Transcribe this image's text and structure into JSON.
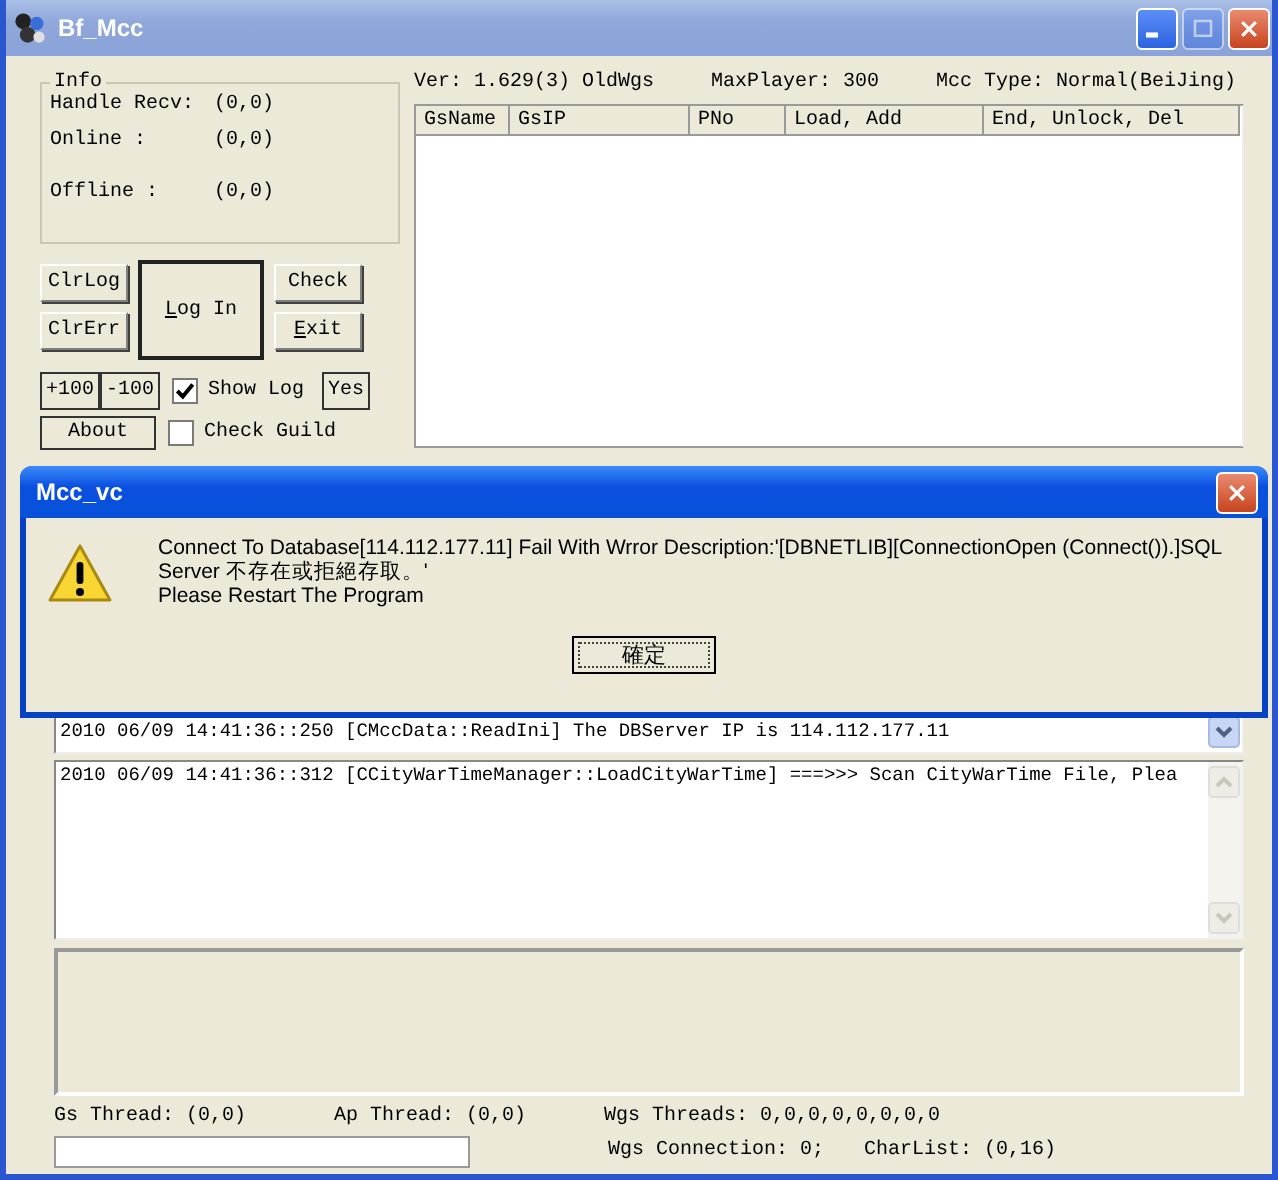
{
  "window": {
    "title": "Bf_Mcc",
    "controls": [
      {
        "kind": "minimize",
        "disabled": false
      },
      {
        "kind": "maximize",
        "disabled": true
      },
      {
        "kind": "close",
        "disabled": false
      }
    ]
  },
  "info": {
    "title": "Info",
    "rows": [
      {
        "label": "Handle Recv:",
        "value": "(0,0)"
      },
      {
        "label": "Online :",
        "value": "(0,0)"
      },
      {
        "label": "Offline :",
        "value": "(0,0)"
      }
    ]
  },
  "buttons": {
    "clr_log": {
      "label": "ClrLog",
      "mnemonic": false
    },
    "clr_err": {
      "label": "ClrErr",
      "mnemonic": false
    },
    "log_in": {
      "label": "Log In",
      "mnemonic": true
    },
    "check": {
      "label": "Check",
      "mnemonic": false
    },
    "exit": {
      "label": "Exit",
      "mnemonic": true
    },
    "plus": {
      "label": "+100",
      "mnemonic": false
    },
    "minus": {
      "label": "-100",
      "mnemonic": false
    },
    "yes": {
      "label": "Yes",
      "mnemonic": false
    },
    "about": {
      "label": "About",
      "mnemonic": false
    }
  },
  "checkboxes": [
    {
      "label": "Show Log",
      "checked": true
    },
    {
      "label": "Check Guild",
      "checked": false
    }
  ],
  "header": [
    "Ver: 1.629(3) OldWgs",
    "MaxPlayer: 300",
    "Mcc Type: Normal(BeiJing)"
  ],
  "table": {
    "columns": [
      "GsName",
      "GsIP",
      "PNo",
      "Load, Add",
      "End, Unlock, Del"
    ]
  },
  "log_upper": [
    "2010 06/09 14:41:36::250 [CMccData::ReadIni] The DBServer IP is 114.112.177.11"
  ],
  "log_lower": [
    "2010 06/09 14:41:36::312 [CCityWarTimeManager::LoadCityWarTime] ===>>> Scan CityWarTime File, Plea"
  ],
  "status": {
    "gs_thread": "Gs Thread: (0,0)",
    "ap_thread": "Ap Thread: (0,0)",
    "wgs_threads": "Wgs Threads: 0,0,0,0,0,0,0,0",
    "wgs_connection": "Wgs Connection: 0;",
    "charlist": "CharList: (0,16)"
  },
  "dialog": {
    "title": "Mcc_vc",
    "lines": [
      "Connect To Database[114.112.177.11] Fail With Wrror Description:'[DBNETLIB][ConnectionOpen (Connect()).]SQL",
      "Server 不存在或拒絕存取。'",
      "Please Restart The Program"
    ],
    "button": "確定"
  }
}
